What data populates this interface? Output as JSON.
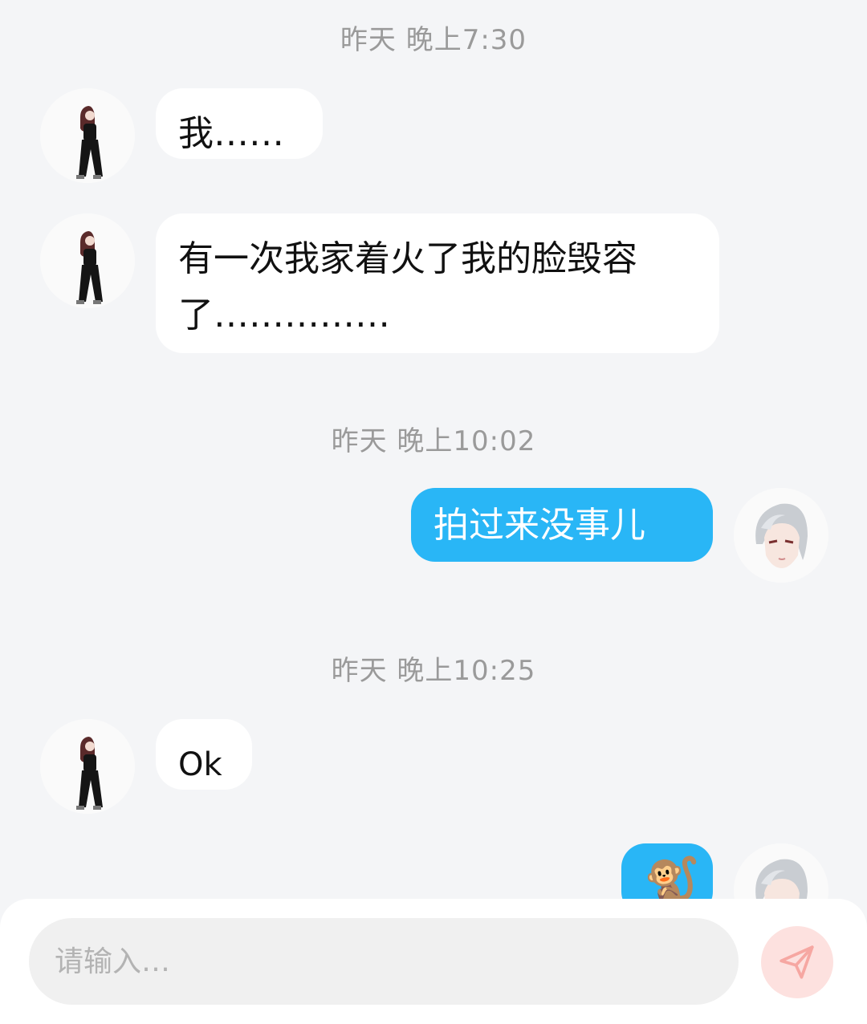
{
  "messages": [
    {
      "timestamp": "昨天 晚上7:30",
      "sender": "contact",
      "text": "我……"
    },
    {
      "sender": "contact",
      "text": "有一次我家着火了我的脸毁容了……………"
    },
    {
      "timestamp": "昨天 晚上10:02",
      "sender": "me",
      "text": "拍过来没事儿"
    },
    {
      "timestamp": "昨天 晚上10:25",
      "sender": "contact",
      "text": "Ok"
    },
    {
      "sender": "me",
      "text": "🐒"
    }
  ],
  "composer": {
    "placeholder": "请输入…"
  },
  "icons": {
    "send": "send-plane-icon",
    "contact_avatar": "girl-in-black-outfit-avatar",
    "my_avatar": "silver-haired-anime-avatar"
  },
  "colors": {
    "background": "#f4f5f7",
    "outgoing_bubble": "#29b6f6",
    "incoming_bubble": "#ffffff",
    "send_button": "#fde1df",
    "send_icon": "#f6a7a2"
  }
}
